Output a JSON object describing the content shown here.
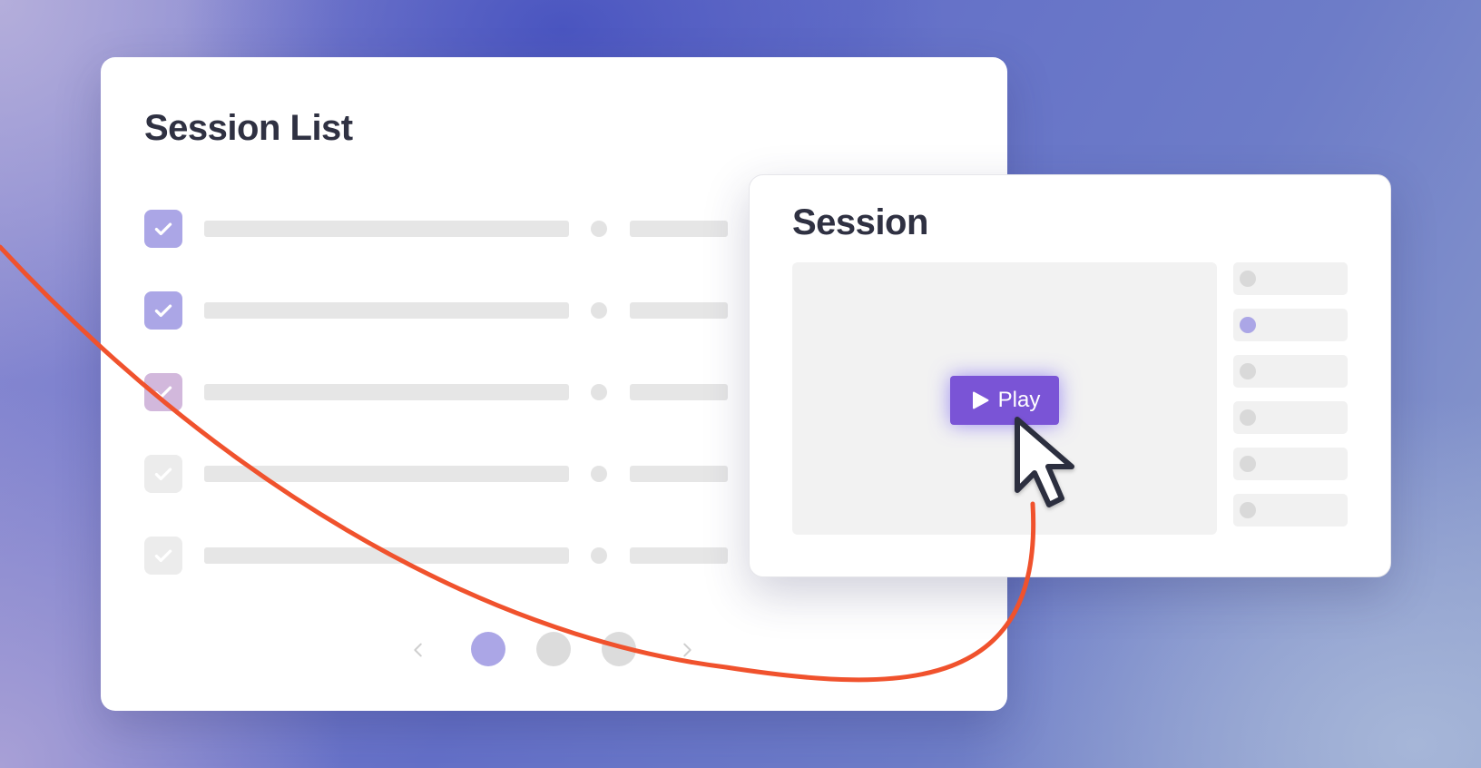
{
  "session_list": {
    "title": "Session List",
    "rows": [
      {
        "checked": true,
        "checkbox_color": "#aba6e6"
      },
      {
        "checked": true,
        "checkbox_color": "#aba6e6"
      },
      {
        "checked": true,
        "checkbox_color": "#d2b8dc"
      },
      {
        "checked": true,
        "checkbox_color": "#ececec"
      },
      {
        "checked": true,
        "checkbox_color": "#ececec"
      }
    ],
    "pagination": {
      "prev_icon": "chevron-left-icon",
      "next_icon": "chevron-right-icon",
      "pages": 3,
      "current_page": 1,
      "active_color": "#aba6e6",
      "inactive_color": "#dcdcdc"
    }
  },
  "session": {
    "title": "Session",
    "play_button": {
      "label": "Play",
      "icon": "play-icon",
      "color": "#7a54d6"
    },
    "side_items": [
      {
        "active": false
      },
      {
        "active": true
      },
      {
        "active": false
      },
      {
        "active": false
      },
      {
        "active": false
      },
      {
        "active": false
      }
    ],
    "side_active_color": "#aba6e6"
  },
  "overlay": {
    "path_color": "#f0522d",
    "cursor_icon": "mouse-pointer-icon"
  }
}
